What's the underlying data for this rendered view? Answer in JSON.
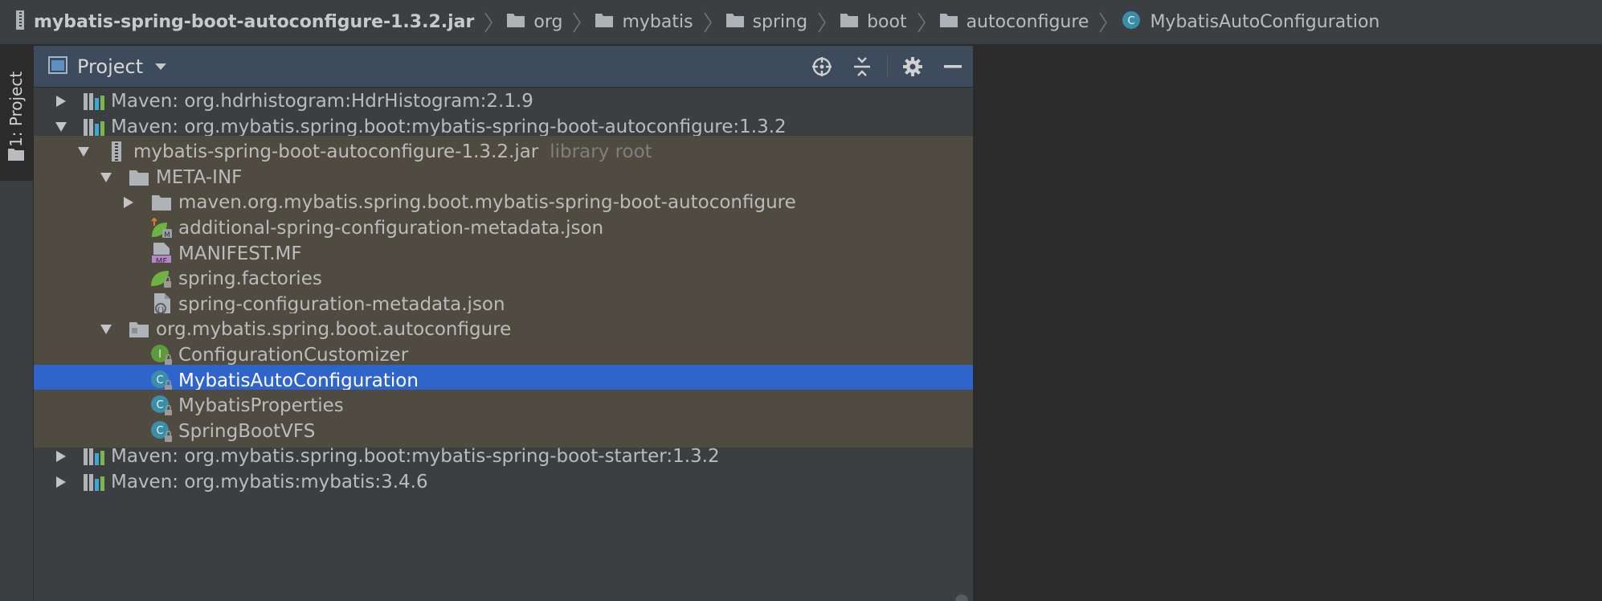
{
  "breadcrumb": [
    {
      "label": "mybatis-spring-boot-autoconfigure-1.3.2.jar",
      "icon": "jar-icon",
      "bold": true
    },
    {
      "label": "org",
      "icon": "folder-icon"
    },
    {
      "label": "mybatis",
      "icon": "folder-icon"
    },
    {
      "label": "spring",
      "icon": "folder-icon"
    },
    {
      "label": "boot",
      "icon": "folder-icon"
    },
    {
      "label": "autoconfigure",
      "icon": "folder-icon"
    },
    {
      "label": "MybatisAutoConfiguration",
      "icon": "class-icon"
    }
  ],
  "toolstrip": {
    "project_tab_label": "1: Project"
  },
  "panel": {
    "title": "Project",
    "tools": [
      "locate-icon",
      "collapse-all-icon",
      "gear-icon",
      "hide-icon"
    ]
  },
  "tree": [
    {
      "label": "Maven: org.hdrhistogram:HdrHistogram:2.1.9",
      "depth": 0,
      "arrow": "right",
      "icon": "maven-library-icon"
    },
    {
      "label": "Maven: org.mybatis.spring.boot:mybatis-spring-boot-autoconfigure:1.3.2",
      "depth": 0,
      "arrow": "down",
      "icon": "maven-library-icon"
    },
    {
      "label": "mybatis-spring-boot-autoconfigure-1.3.2.jar",
      "hint": "library root",
      "depth": 1,
      "arrow": "down",
      "icon": "jar-icon",
      "lib": true
    },
    {
      "label": "META-INF",
      "depth": 2,
      "arrow": "down",
      "icon": "folder-icon",
      "lib": true
    },
    {
      "label": "maven.org.mybatis.spring.boot.mybatis-spring-boot-autoconfigure",
      "depth": 3,
      "arrow": "right",
      "icon": "folder-icon",
      "lib": true
    },
    {
      "label": "additional-spring-configuration-metadata.json",
      "depth": 3,
      "arrow": "none",
      "icon": "spring-metadata-icon",
      "lib": true
    },
    {
      "label": "MANIFEST.MF",
      "depth": 3,
      "arrow": "none",
      "icon": "manifest-icon",
      "lib": true
    },
    {
      "label": "spring.factories",
      "depth": 3,
      "arrow": "none",
      "icon": "spring-leaf-icon",
      "lib": true
    },
    {
      "label": "spring-configuration-metadata.json",
      "depth": 3,
      "arrow": "none",
      "icon": "json-file-icon",
      "lib": true
    },
    {
      "label": "org.mybatis.spring.boot.autoconfigure",
      "depth": 2,
      "arrow": "down",
      "icon": "package-icon",
      "lib": true
    },
    {
      "label": "ConfigurationCustomizer",
      "depth": 3,
      "arrow": "none",
      "icon": "interface-icon",
      "lib": true
    },
    {
      "label": "MybatisAutoConfiguration",
      "depth": 3,
      "arrow": "none",
      "icon": "class-icon",
      "lib": true,
      "selected": true
    },
    {
      "label": "MybatisProperties",
      "depth": 3,
      "arrow": "none",
      "icon": "class-icon",
      "lib": true
    },
    {
      "label": "SpringBootVFS",
      "depth": 3,
      "arrow": "none",
      "icon": "class-icon",
      "lib": true
    },
    {
      "label": "Maven: org.mybatis.spring.boot:mybatis-spring-boot-starter:1.3.2",
      "depth": 0,
      "arrow": "right",
      "icon": "maven-library-icon"
    },
    {
      "label": "Maven: org.mybatis:mybatis:3.4.6",
      "depth": 0,
      "arrow": "right",
      "icon": "maven-library-icon"
    }
  ],
  "colors": {
    "selection": "#2f65ca",
    "library_root_bg": "#4f4b41",
    "panel_header": "#3d4b5c",
    "class_icon": "#3a8fa8",
    "interface_icon": "#5c9a3c",
    "spring_green": "#6db33f"
  }
}
